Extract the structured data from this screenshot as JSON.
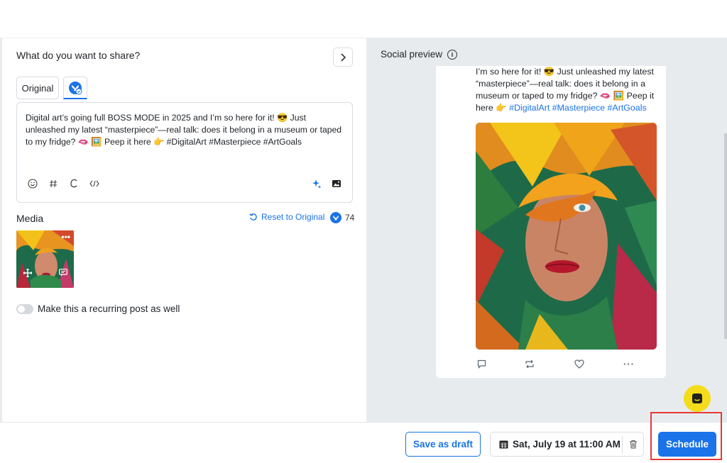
{
  "composer": {
    "heading": "What do you want to share?",
    "tabs": [
      {
        "label": "Original",
        "icon": "text-tab"
      },
      {
        "label": "",
        "icon": "bluesky-icon",
        "active": true
      }
    ],
    "post_text": "Digital art’s going full BOSS MODE in 2025 and I’m so here for it! 😎 Just unleashed my latest “masterpiece”—real talk: does it belong in a museum or taped to my fridge? 🫦 🖼️ Peep it here 👉 #DigitalArt #Masterpiece #ArtGoals",
    "toolbar_icons": [
      "emoji-icon",
      "hashtag-icon",
      "signature-icon",
      "code-icon",
      "ai-sparkle-icon",
      "image-edit-icon"
    ]
  },
  "media": {
    "label": "Media",
    "reset_label": "Reset to Original",
    "char_count": "74",
    "recurring_label": "Make this a recurring post as well",
    "recurring_on": false
  },
  "preview": {
    "title": "Social preview",
    "text_main": "I’m so here for it! 😎 Just unleashed my latest “masterpiece”—real talk: does it belong in a museum or taped to my fridge? 🫦 🖼️ Peep it here 👉",
    "hashtags": "#DigitalArt #Masterpiece #ArtGoals",
    "actions": [
      "reply-icon",
      "repost-icon",
      "like-icon",
      "more-icon"
    ]
  },
  "footer": {
    "draft_label": "Save as draft",
    "schedule_date": "Sat, July 19 at 11:00 AM",
    "schedule_label": "Schedule"
  },
  "colors": {
    "accent": "#1a73e8",
    "preview_bg": "#e8ebee",
    "help_bubble": "#f4dc1a",
    "highlight": "#e53935"
  }
}
